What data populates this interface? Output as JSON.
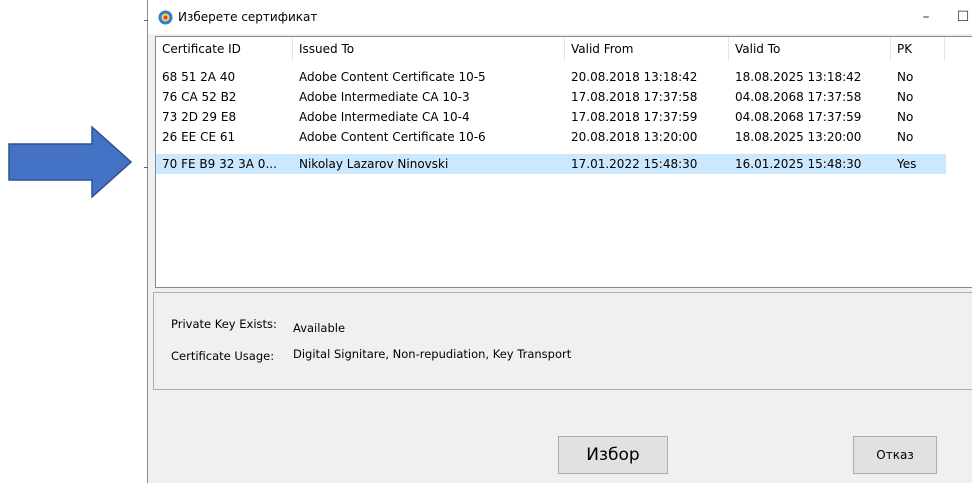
{
  "window": {
    "title": "Изберете сертификат",
    "controls": {
      "minimize": "–",
      "maximize": "☐",
      "close": "✕"
    }
  },
  "table": {
    "columns": [
      "Certificate ID",
      "Issued To",
      "Valid From",
      "Valid To",
      "PK"
    ],
    "rows": [
      [
        "68 51 2A 40",
        "Adobe Content Certificate 10-5",
        "20.08.2018 13:18:42",
        "18.08.2025 13:18:42",
        "No"
      ],
      [
        "76 CA 52 B2",
        "Adobe Intermediate CA 10-3",
        "17.08.2018 17:37:58",
        "04.08.2068 17:37:58",
        "No"
      ],
      [
        "73 2D 29 E8",
        "Adobe Intermediate CA 10-4",
        "17.08.2018 17:37:59",
        "04.08.2068 17:37:59",
        "No"
      ],
      [
        "26 EE CE 61",
        "Adobe Content Certificate 10-6",
        "20.08.2018 13:20:00",
        "18.08.2025 13:20:00",
        "No"
      ],
      [
        "70 FE B9 32 3A 0...",
        "Nikolay Lazarov Ninovski",
        "17.01.2022 15:48:30",
        "16.01.2025 15:48:30",
        "Yes"
      ]
    ],
    "selected_row": 4
  },
  "details": {
    "private_key_label": "Private Key Exists:",
    "private_key_value": "Available",
    "usage_label": "Certificate Usage:",
    "usage_value": "Digital Signitare, Non-repudiation, Key Transport"
  },
  "buttons": {
    "select": "Избор",
    "cancel": "Отказ"
  },
  "colors": {
    "arrow": "#4472c4",
    "selection": "#cce8ff"
  }
}
